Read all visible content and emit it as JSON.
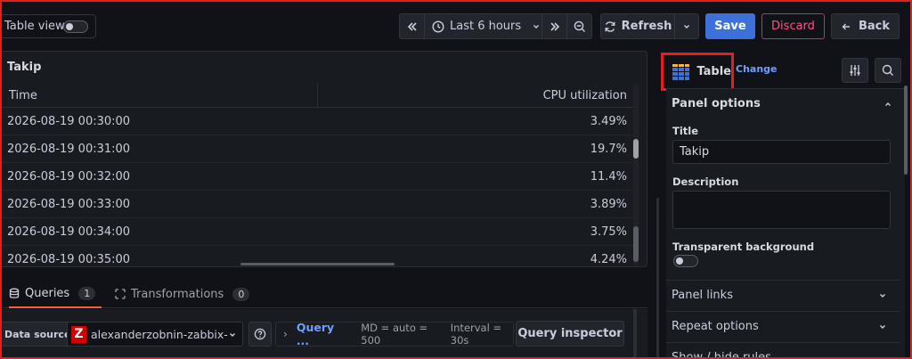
{
  "toolbar": {
    "table_view_label": "Table view",
    "time_range": "Last 6 hours",
    "refresh_label": "Refresh",
    "save_label": "Save",
    "discard_label": "Discard",
    "back_label": "Back"
  },
  "panel": {
    "title": "Takip",
    "columns": [
      "Time",
      "CPU utilization"
    ],
    "rows": [
      {
        "time": "2026-08-19 00:30:00",
        "cpu": "3.49%"
      },
      {
        "time": "2026-08-19 00:31:00",
        "cpu": "19.7%"
      },
      {
        "time": "2026-08-19 00:32:00",
        "cpu": "11.4%"
      },
      {
        "time": "2026-08-19 00:33:00",
        "cpu": "3.89%"
      },
      {
        "time": "2026-08-19 00:34:00",
        "cpu": "3.75%"
      },
      {
        "time": "2026-08-19 00:35:00",
        "cpu": "4.24%"
      }
    ]
  },
  "tabs": [
    {
      "label": "Queries",
      "count": "1"
    },
    {
      "label": "Transformations",
      "count": "0"
    }
  ],
  "query": {
    "datasource_label": "Data source",
    "datasource_value": "alexanderzobnin-zabbix-d",
    "datasource_logo": "Z",
    "query_link": "Query ...",
    "md": "MD = auto = 500",
    "interval": "Interval = 30s",
    "inspector_label": "Query inspector"
  },
  "options": {
    "viz_label": "Table",
    "change_label": "Change",
    "panel_options_label": "Panel options",
    "title_label": "Title",
    "title_value": "Takip",
    "description_label": "Description",
    "transparent_label": "Transparent background",
    "panel_links_label": "Panel links",
    "repeat_options_label": "Repeat options",
    "show_hide_label": "Show / hide rules"
  },
  "colors": {
    "accent": "#3d71d9",
    "discard": "#e0226e",
    "highlight": "#e02020"
  }
}
